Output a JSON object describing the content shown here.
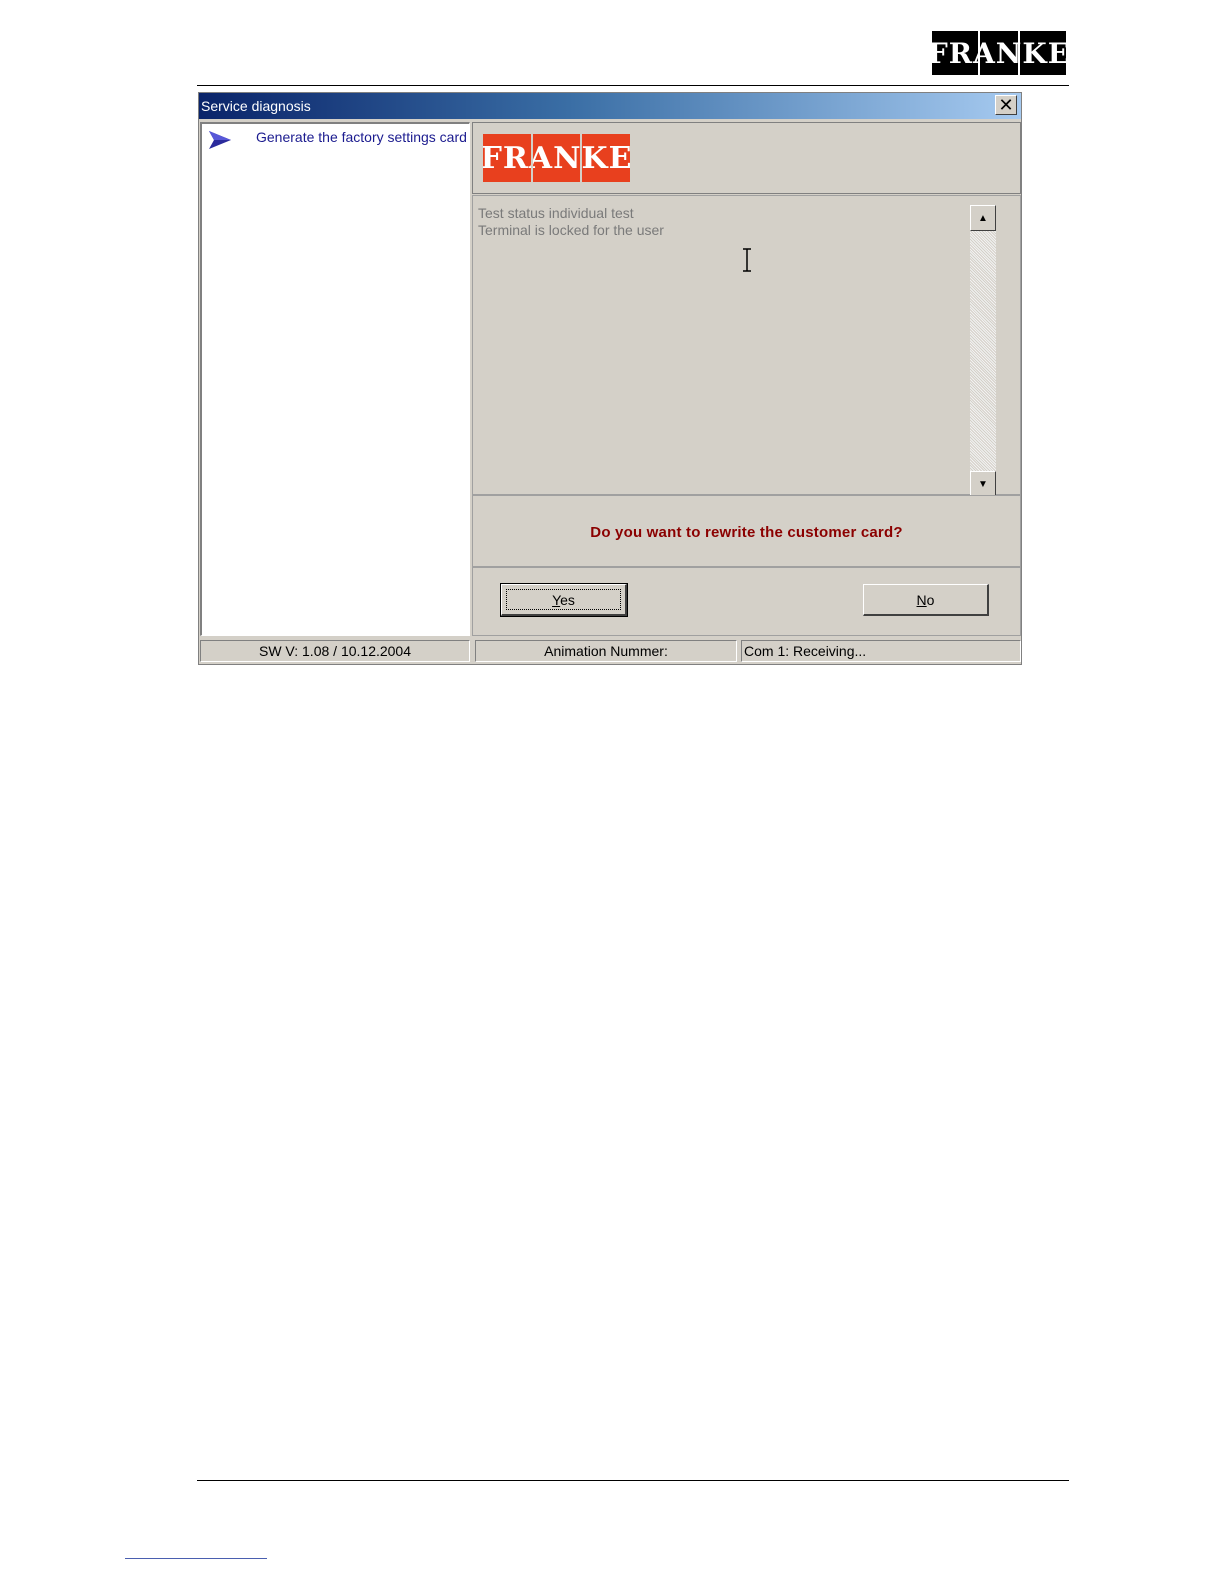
{
  "document": {
    "logo_text": "FRANKE"
  },
  "window": {
    "title": "Service diagnosis",
    "close_label": "✕"
  },
  "list": {
    "items": [
      {
        "label": "Generate the factory settings card",
        "icon": "arrow-right-icon"
      }
    ]
  },
  "brand": {
    "logo_text": "FRANKE",
    "logo_color": "#e8401e"
  },
  "log": {
    "lines": [
      "Test status individual test",
      "Terminal is locked for the user"
    ],
    "scroll_up": "▲",
    "scroll_down": "▼"
  },
  "prompt": {
    "text": "Do you want to rewrite the customer card?",
    "color": "#8b0000"
  },
  "buttons": {
    "yes": "Yes",
    "no": "No"
  },
  "status": {
    "software": "SW V: 1.08 / 10.12.2004",
    "animation": "Animation Nummer:",
    "com": "Com 1: Receiving..."
  }
}
